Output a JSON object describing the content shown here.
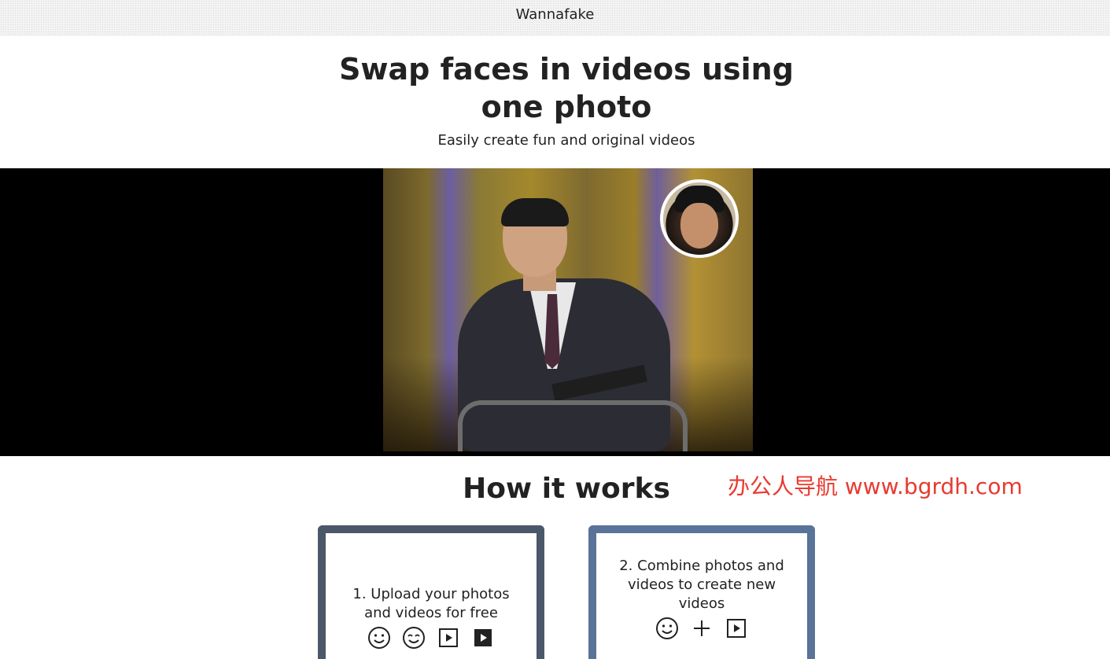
{
  "header": {
    "brand": "Wannafake"
  },
  "hero": {
    "title": "Swap faces in videos using one photo",
    "subtitle": "Easily create fun and original videos"
  },
  "watermark": {
    "text": "办公人导航 www.bgrdh.com",
    "color": "#e83a30"
  },
  "how_it_works": {
    "title": "How it works",
    "steps": [
      {
        "text": "1. Upload your photos and videos for free",
        "icons": [
          "smile-icon",
          "smile-eyes-closed-icon",
          "play-outline-icon",
          "play-filled-icon"
        ],
        "border_color": "#4b5869"
      },
      {
        "text": "2. Combine photos and videos to create new videos",
        "icons": [
          "smile-icon",
          "plus-icon",
          "play-outline-icon"
        ],
        "border_color": "#5a7398"
      }
    ]
  },
  "colors": {
    "video_band": "#000000",
    "text": "#222222"
  }
}
